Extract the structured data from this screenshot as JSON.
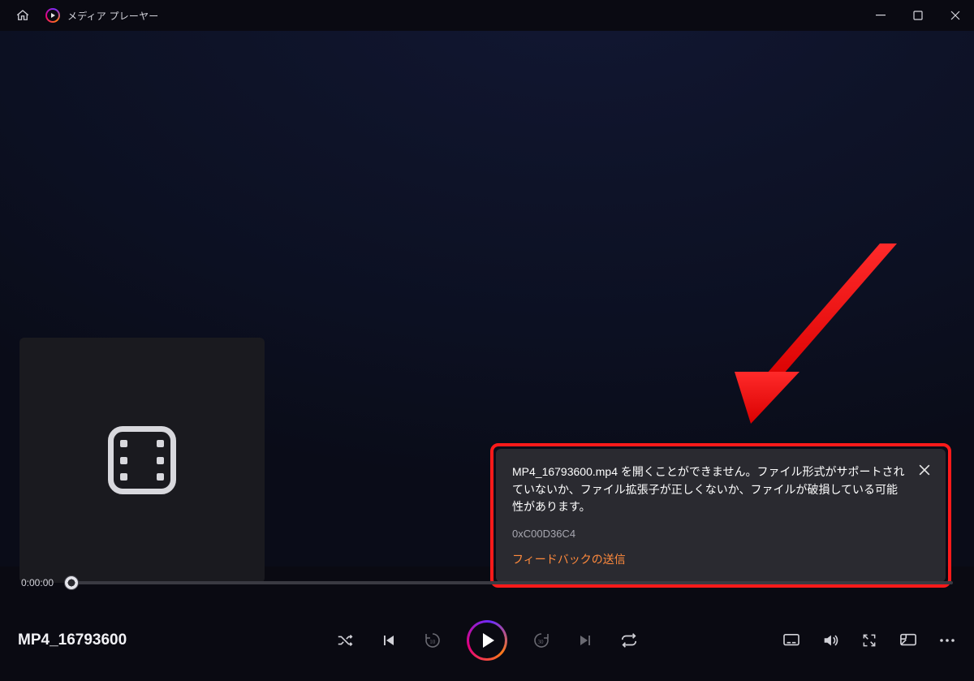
{
  "titlebar": {
    "app_name": "メディア プレーヤー"
  },
  "seek": {
    "current_time": "0:00:00"
  },
  "media": {
    "title": "MP4_16793600"
  },
  "error": {
    "message": "MP4_16793600.mp4 を開くことができません。ファイル形式がサポートされていないか、ファイル拡張子が正しくないか、ファイルが破損している可能性があります。",
    "code": "0xC00D36C4",
    "feedback_label": "フィードバックの送信"
  },
  "icons": {
    "home": "home-icon",
    "app": "media-player-app-icon",
    "minimize": "minimize-icon",
    "maximize": "maximize-icon",
    "close": "close-icon",
    "film_placeholder": "film-icon",
    "shuffle": "shuffle-icon",
    "prev": "previous-icon",
    "back10": "skip-back-10-icon",
    "play": "play-icon",
    "fwd30": "skip-forward-30-icon",
    "next": "next-icon",
    "repeat": "repeat-icon",
    "cc": "captions-icon",
    "volume": "volume-icon",
    "fullscreen": "fullscreen-icon",
    "mini": "mini-player-icon",
    "more": "more-icon",
    "toast_close": "toast-close-icon"
  }
}
